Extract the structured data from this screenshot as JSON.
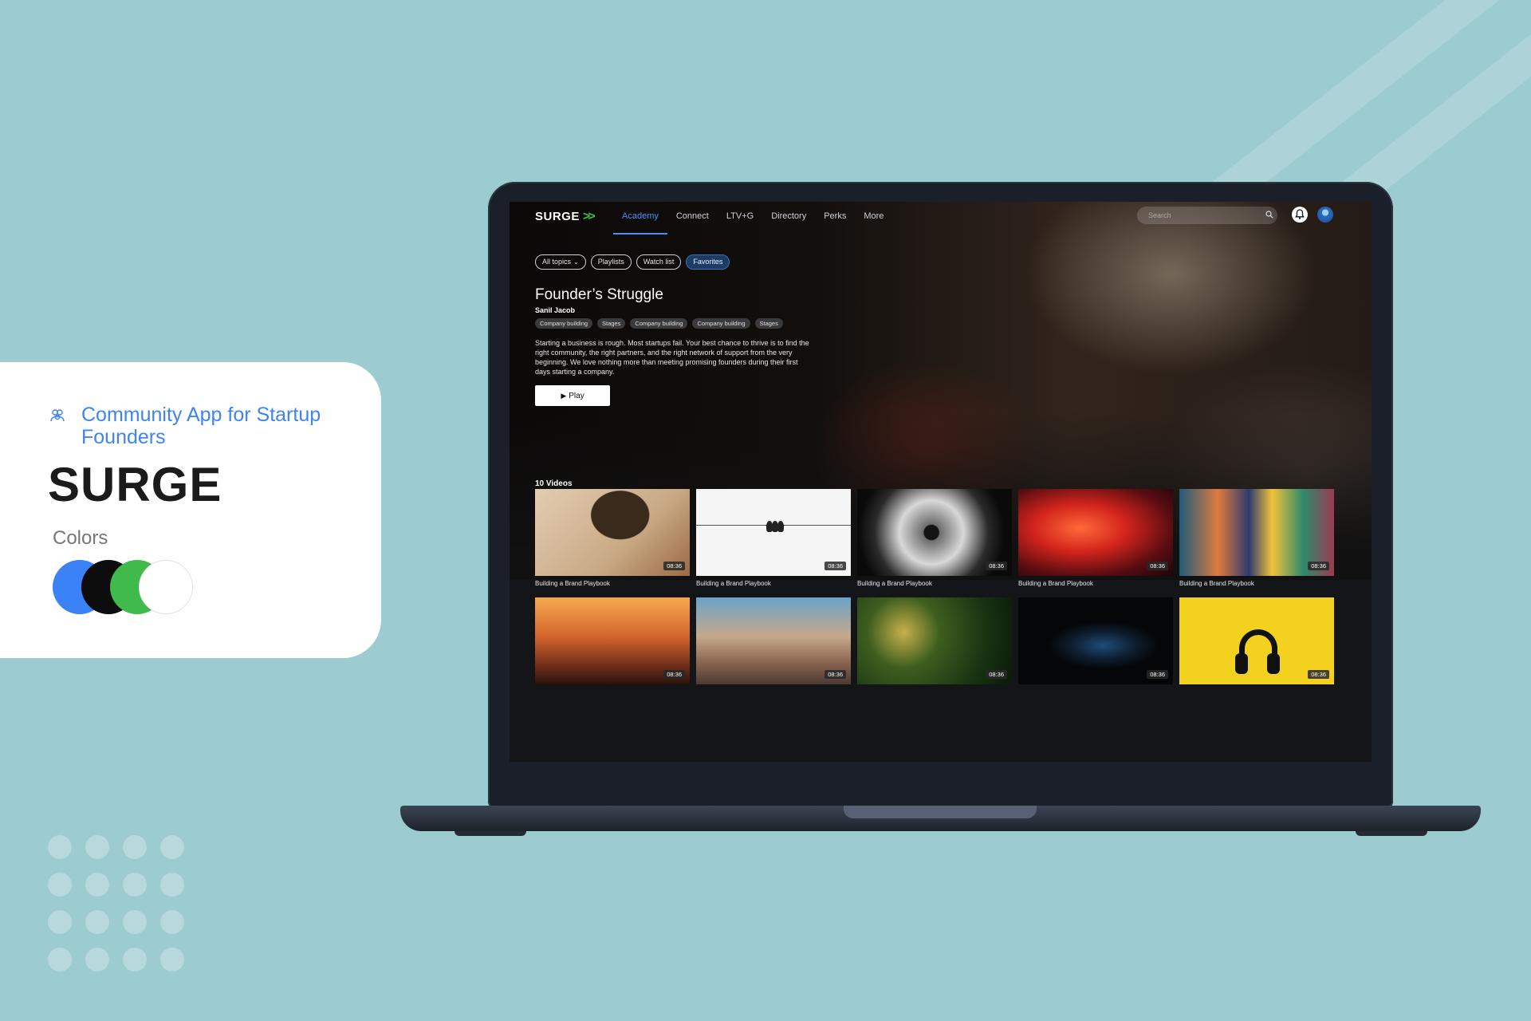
{
  "showcase": {
    "subtitle": "Community App for Startup Founders",
    "title": "SURGE",
    "colors_label": "Colors",
    "palette": [
      "#3b82f6",
      "#0c0c0c",
      "#3fba4b",
      "#ffffff"
    ]
  },
  "app": {
    "logo": "SURGE",
    "logo_mark": ">>",
    "nav": [
      "Academy",
      "Connect",
      "LTV+G",
      "Directory",
      "Perks",
      "More"
    ],
    "active_nav": "Academy",
    "search_placeholder": "Search",
    "filters": {
      "all_topics": "All topics",
      "playlists": "Playlists",
      "watch_list": "Watch list",
      "favorites": "Favorites"
    },
    "featured": {
      "title": "Founder’s Struggle",
      "author": "Sanil Jacob",
      "tags": [
        "Company building",
        "Stages",
        "Company building",
        "Company building",
        "Stages"
      ],
      "description": "Starting a business is rough. Most startups fail. Your best chance to thrive is to find the right community, the right partners, and the right network of support from the very beginning. We love nothing more than meeting promising founders during their first days starting a company.",
      "play_label": "Play"
    },
    "videos_label": "10 Videos",
    "videos": [
      {
        "title": "Building a Brand Playbook",
        "duration": "08:36"
      },
      {
        "title": "Building a Brand Playbook",
        "duration": "08:36"
      },
      {
        "title": "Building a Brand Playbook",
        "duration": "08:36"
      },
      {
        "title": "Building a Brand Playbook",
        "duration": "08:36"
      },
      {
        "title": "Building a Brand Playbook",
        "duration": "08:36"
      },
      {
        "title": "",
        "duration": "08:36"
      },
      {
        "title": "",
        "duration": "08:36"
      },
      {
        "title": "",
        "duration": "08:36"
      },
      {
        "title": "",
        "duration": "08:36"
      },
      {
        "title": "",
        "duration": "08:36"
      }
    ]
  },
  "colors": {
    "background": "#9ccbd0",
    "accent_blue": "#3f84f0",
    "brand_green": "#3fba4b"
  }
}
